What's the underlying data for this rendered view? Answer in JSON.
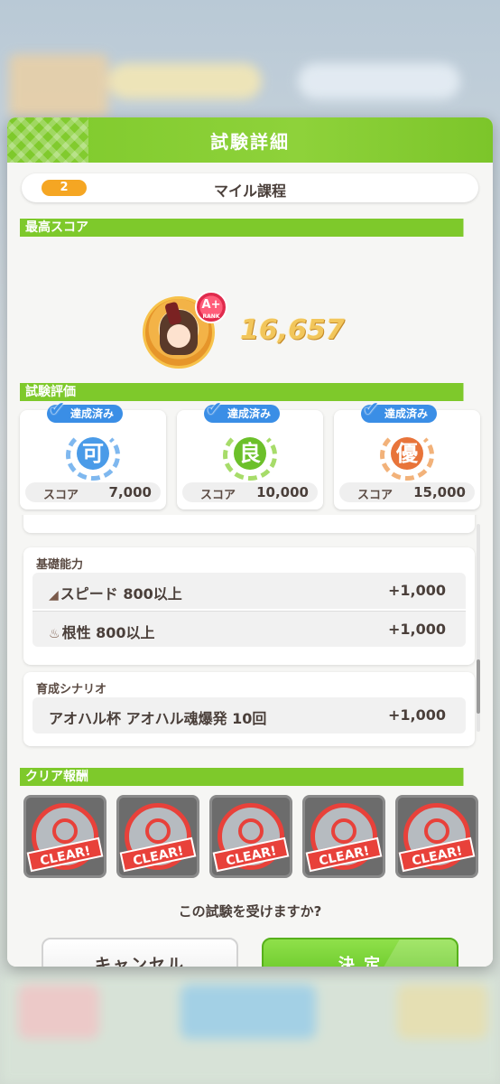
{
  "dialog": {
    "title": "試験詳細",
    "course_number": "2",
    "course_name": "マイル課程",
    "best_score_section": "最高スコア",
    "best_score": "16,657",
    "rank": "A+",
    "rank_sub": "RANK",
    "evaluation_section": "試験評価",
    "evaluations": [
      {
        "status": "達成済み",
        "grade": "可",
        "score_label": "スコア",
        "score": "7,000",
        "color": "#4a9be8"
      },
      {
        "status": "達成済み",
        "grade": "良",
        "score_label": "スコア",
        "score": "10,000",
        "color": "#6cc02a"
      },
      {
        "status": "達成済み",
        "grade": "優",
        "score_label": "スコア",
        "score": "15,000",
        "color": "#e8743a"
      }
    ],
    "groups": {
      "basic": {
        "title": "基礎能力",
        "rows": [
          {
            "label": "スピード 800以上",
            "bonus": "+1,000"
          },
          {
            "label": "根性 800以上",
            "bonus": "+1,000"
          }
        ]
      },
      "scenario": {
        "title": "育成シナリオ",
        "rows": [
          {
            "label": "アオハル杯 アオハル魂爆発 10回",
            "bonus": "+1,000"
          }
        ]
      }
    },
    "reward_section": "クリア報酬",
    "rewards": [
      {
        "stamp": "CLEAR!"
      },
      {
        "stamp": "CLEAR!"
      },
      {
        "stamp": "CLEAR!"
      },
      {
        "stamp": "CLEAR!"
      },
      {
        "stamp": "CLEAR!"
      }
    ],
    "question": "この試験を受けますか?",
    "cancel_label": "キャンセル",
    "ok_label": "決 定"
  },
  "colors": {
    "accent_green": "#7ec92b",
    "badge_orange": "#f5a623",
    "status_blue": "#3a8ee6",
    "clear_red": "#e8413a"
  }
}
